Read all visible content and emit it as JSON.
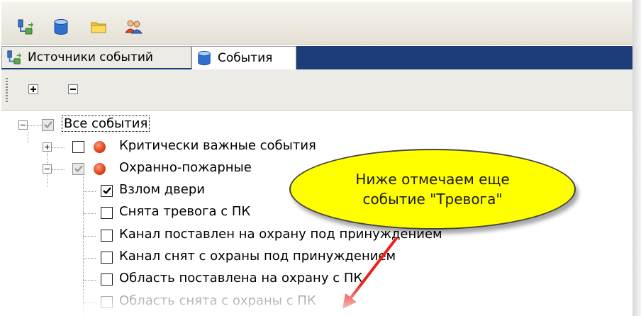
{
  "toolbar": {
    "icons": [
      "event-sources-icon",
      "database-icon",
      "folder-icon",
      "users-icon"
    ]
  },
  "tabs": [
    {
      "label": "Источники событий",
      "icon": "event-sources-icon",
      "active": false
    },
    {
      "label": "События",
      "icon": "database-icon",
      "active": true
    }
  ],
  "subtoolbar": {
    "buttons": [
      "expand-all-icon",
      "collapse-all-icon"
    ]
  },
  "tree": {
    "root": {
      "label": "Все события",
      "checked": "indeterminate",
      "expanded": true
    },
    "groups": [
      {
        "label": "Критически важные события",
        "checked": false,
        "expanded": false,
        "severity_color": "#e2451d"
      },
      {
        "label": "Охранно-пожарные",
        "checked": "indeterminate",
        "expanded": true,
        "severity_color": "#e2451d"
      }
    ],
    "items": [
      {
        "label": "Взлом двери",
        "checked": true
      },
      {
        "label": "Снята тревога с ПК",
        "checked": false
      },
      {
        "label": "Канал поставлен на охрану под принуждением",
        "checked": false
      },
      {
        "label": "Канал снят с охраны под принуждением",
        "checked": false
      },
      {
        "label": "Область поставлена на охрану с ПК",
        "checked": false
      },
      {
        "label": "Область снята с охраны с ПК",
        "checked": false
      }
    ]
  },
  "callout": {
    "line1": "Ниже отмечаем еще",
    "line2": "событие \"Тревога\"",
    "color": "#ffff00",
    "arrow_color": "#e8231c"
  },
  "colors": {
    "tab_strip": "#1c3d79",
    "toolbar": "#ecebe5"
  }
}
